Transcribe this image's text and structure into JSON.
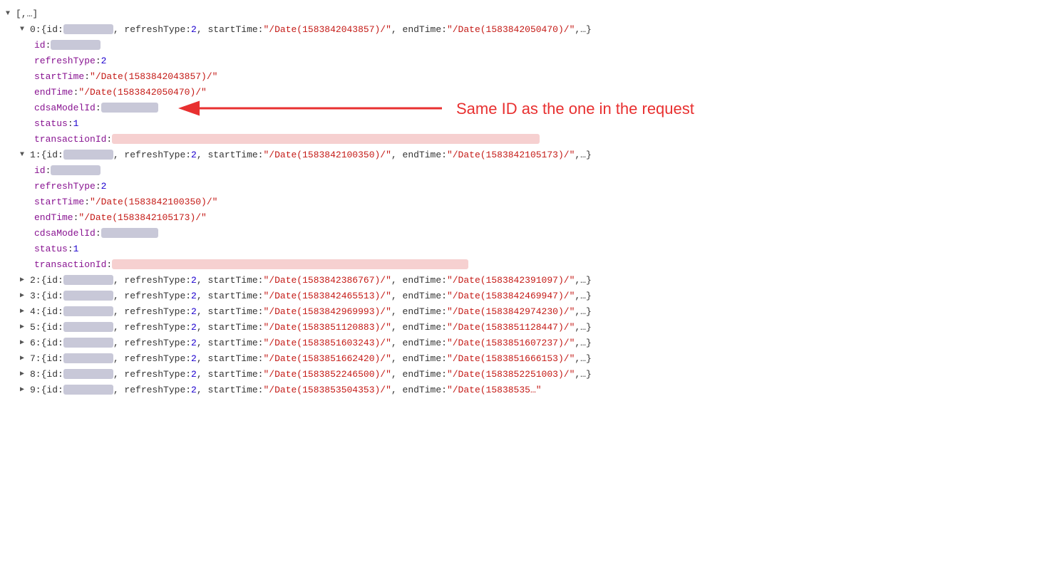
{
  "viewer": {
    "root_label": "[,…]",
    "annotation_text": "Same ID as the one in the request",
    "items": [
      {
        "index": 0,
        "expanded": true,
        "summary": "{id: [blurred], refreshType: 2, startTime: \"/Date(1583842043857)/\", endTime: \"/Date(1583842050470)/\",…}",
        "fields": [
          {
            "key": "id",
            "value_type": "blurred"
          },
          {
            "key": "refreshType",
            "value": "2",
            "value_type": "number"
          },
          {
            "key": "startTime",
            "value": "\"/Date(1583842043857)/\"",
            "value_type": "string"
          },
          {
            "key": "endTime",
            "value": "\"/Date(1583842050470)/\"",
            "value_type": "string"
          },
          {
            "key": "cdsaModelId",
            "value_type": "blurred_cdsa",
            "annotated": true
          },
          {
            "key": "status",
            "value": "1",
            "value_type": "number"
          },
          {
            "key": "transactionId",
            "value_type": "blurred_wide"
          }
        ]
      },
      {
        "index": 1,
        "expanded": true,
        "summary": "{id: [blurred], refreshType: 2, startTime: \"/Date(1583842100350)/\", endTime: \"/Date(1583842105173)/\",…}",
        "fields": [
          {
            "key": "id",
            "value_type": "blurred"
          },
          {
            "key": "refreshType",
            "value": "2",
            "value_type": "number"
          },
          {
            "key": "startTime",
            "value": "\"/Date(1583842100350)/\"",
            "value_type": "string"
          },
          {
            "key": "endTime",
            "value": "\"/Date(1583842105173)/\"",
            "value_type": "string"
          },
          {
            "key": "cdsaModelId",
            "value_type": "blurred_cdsa"
          },
          {
            "key": "status",
            "value": "1",
            "value_type": "number"
          },
          {
            "key": "transactionId",
            "value_type": "blurred_medium"
          }
        ]
      },
      {
        "index": 2,
        "expanded": false,
        "summary": "{id: [blurred], refreshType: 2, startTime: \"/Date(1583842386767)/\", endTime: \"/Date(1583842391097)/\",…}"
      },
      {
        "index": 3,
        "expanded": false,
        "summary": "{id: [blurred], refreshType: 2, startTime: \"/Date(1583842465513)/\", endTime: \"/Date(1583842469947)/\",…}"
      },
      {
        "index": 4,
        "expanded": false,
        "summary": "{id: [blurred], refreshType: 2, startTime: \"/Date(1583842969993)/\", endTime: \"/Date(1583842974230)/\",…}"
      },
      {
        "index": 5,
        "expanded": false,
        "summary": "{id: [blurred], refreshType: 2, startTime: \"/Date(1583851120883)/\", endTime: \"/Date(1583851128447)/\",…}"
      },
      {
        "index": 6,
        "expanded": false,
        "summary": "{id: [blurred], refreshType: 2, startTime: \"/Date(1583851603243)/\", endTime: \"/Date(1583851607237)/\",…}"
      },
      {
        "index": 7,
        "expanded": false,
        "summary": "{id: [blurred], refreshType: 2, startTime: \"/Date(1583851662420)/\", endTime: \"/Date(1583851666153)/\",…}"
      },
      {
        "index": 8,
        "expanded": false,
        "summary": "{id: [blurred], refreshType: 2, startTime: \"/Date(1583852246500)/\", endTime: \"/Date(1583852251003)/\",…}"
      },
      {
        "index": 9,
        "expanded": false,
        "summary": "{id: [blurred], refreshType: 2, startTime: \"/Date(1583853504353)/\", endTime: \"/Date(15838535…"
      }
    ]
  }
}
